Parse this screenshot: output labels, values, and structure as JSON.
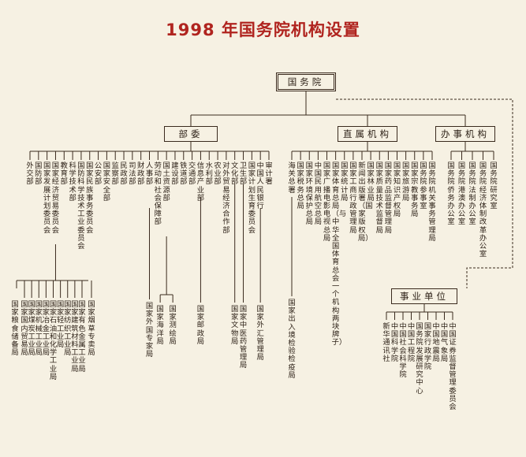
{
  "title": "1998 年国务院机构设置",
  "root": "国务院",
  "groups": {
    "ministries": "部委",
    "direct": "直属机构",
    "offices": "办事机构",
    "institutions": "事业单位"
  },
  "ministries": [
    "外交部",
    "国防部",
    "国家发展计划委员会",
    "国家经济贸易委员会",
    "教育部",
    "科学技术部",
    "国防科学技术工业委员会",
    "国家民族事务委员会",
    "公安部",
    "国家安全部",
    "监察部",
    "民政部",
    "司法部",
    "财政部",
    "人事部",
    "劳动和社会保障部",
    "国土资源部",
    "建设部",
    "铁道部",
    "交通部",
    "信息产业部",
    "水利部",
    "农业部",
    "对外贸易经济合作部",
    "文化部",
    "卫生部",
    "国家计划生育委员会",
    "中国人民银行",
    "审计署"
  ],
  "ministry_sub": {
    "ecotrade": [
      "国家国内贸易局",
      "国家煤炭工业局",
      "国家机械工业局",
      "国家冶金工业局",
      "国家石油和化学工业局",
      "国家轻工业局",
      "国家纺织工业局",
      "国家建筑材料工业局",
      "国家有色金属工业局"
    ],
    "grain": "国家粮食储备局",
    "tobacco": "国家烟草专卖局",
    "personnel": "国家外国专家局",
    "land": [
      "国家海洋局",
      "国家测绘局"
    ],
    "info": "国家邮政局",
    "culture": "国家文物局",
    "health": "国家中医药管理局",
    "bank": "国家外汇管理局"
  },
  "direct_bodies": [
    "海关总署",
    "国家税务总局",
    "国家环境保护总局",
    "中国民用航空总局",
    "国家广播电影电视总局",
    "国家体育总局（与中华全国体育总会一个机构两块牌子）",
    "国家统计局",
    "国家工商行政管理局",
    "新闻出版署（国家版权局）",
    "国家林业局",
    "国家质量技术监督局",
    "国家药品监督管理局",
    "国家知识产权局",
    "国家旅游局",
    "国家宗教事务局",
    "国务院参事室",
    "国务院机关事务管理局"
  ],
  "direct_sub": "国家出入境检验检疫局",
  "offices": [
    "国务院侨务办公室",
    "国务院港澳办公室",
    "国务院法制办公室",
    "国务院经济体制改革办公室",
    "国务院研究室"
  ],
  "institutions": [
    "新华通讯社",
    "中国科学院",
    "中国社会科学院",
    "中国工程院",
    "国务院发展研究中心",
    "国家行政学院",
    "中国地震局",
    "中国气象局",
    "中国证券监督管理委员会"
  ]
}
